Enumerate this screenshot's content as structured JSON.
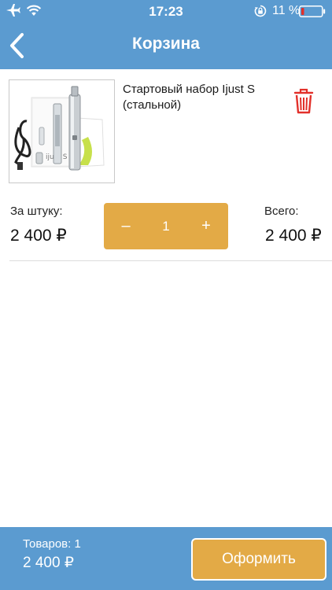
{
  "status_bar": {
    "time": "17:23",
    "battery_percent": "11 %",
    "icons": [
      "airplane-icon",
      "wifi-icon",
      "orientation-lock-icon",
      "battery-low-icon"
    ]
  },
  "nav": {
    "title": "Корзина",
    "back_icon": "chevron-left-icon"
  },
  "cart": {
    "items": [
      {
        "name": "Стартовый набор Ijust S (стальной)",
        "unit_label": "За штуку:",
        "unit_price": "2 400 ₽",
        "quantity": "1",
        "minus": "–",
        "plus": "+",
        "total_label": "Всего:",
        "total_price": "2 400 ₽"
      }
    ]
  },
  "footer": {
    "count_text": "Товаров: 1",
    "sum": "2 400 ₽",
    "checkout_label": "Оформить"
  },
  "colors": {
    "header_blue": "#5b9bd0",
    "accent_orange": "#e3aa46",
    "delete_red": "#e2302a"
  }
}
